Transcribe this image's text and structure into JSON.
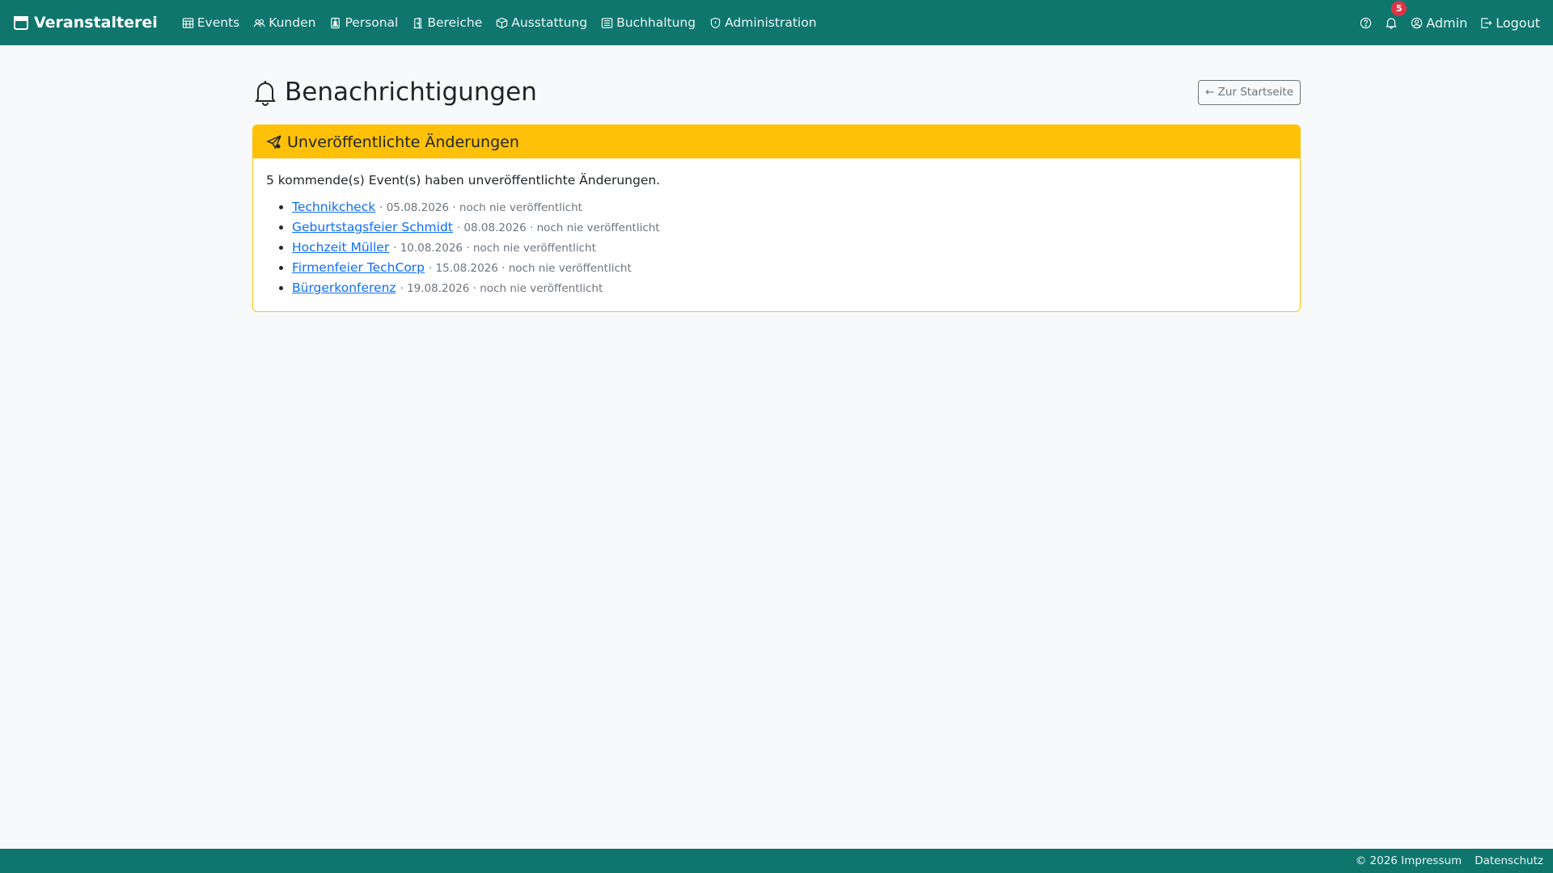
{
  "navbar": {
    "brand": "Veranstalterei",
    "items": [
      {
        "label": "Events",
        "icon": "calendar-grid-icon"
      },
      {
        "label": "Kunden",
        "icon": "people-icon"
      },
      {
        "label": "Personal",
        "icon": "person-badge-icon"
      },
      {
        "label": "Bereiche",
        "icon": "door-icon"
      },
      {
        "label": "Ausstattung",
        "icon": "box-icon"
      },
      {
        "label": "Buchhaltung",
        "icon": "ledger-icon"
      },
      {
        "label": "Administration",
        "icon": "shield-icon"
      }
    ],
    "notification_count": "5",
    "user_label": "Admin",
    "logout_label": "Logout"
  },
  "page": {
    "title": "Benachrichtigungen",
    "back_button": "← Zur Startseite"
  },
  "card": {
    "header": "Unveröffentlichte Änderungen",
    "intro": "5 kommende(s) Event(s) haben unveröffentlichte Änderungen.",
    "events": [
      {
        "name": "Technikcheck",
        "meta": "· 05.08.2026 · noch nie veröffentlicht"
      },
      {
        "name": "Geburtstagsfeier Schmidt",
        "meta": "· 08.08.2026 · noch nie veröffentlicht"
      },
      {
        "name": "Hochzeit Müller",
        "meta": "· 10.08.2026 · noch nie veröffentlicht"
      },
      {
        "name": "Firmenfeier TechCorp",
        "meta": "· 15.08.2026 · noch nie veröffentlicht"
      },
      {
        "name": "Bürgerkonferenz",
        "meta": "· 19.08.2026 · noch nie veröffentlicht"
      }
    ]
  },
  "footer": {
    "impressum": "© 2026 Impressum",
    "datenschutz": "Datenschutz"
  },
  "colors": {
    "navbar": "#0f766e",
    "warning": "#ffc107",
    "link": "#0d6efd",
    "badge": "#dc3545"
  }
}
